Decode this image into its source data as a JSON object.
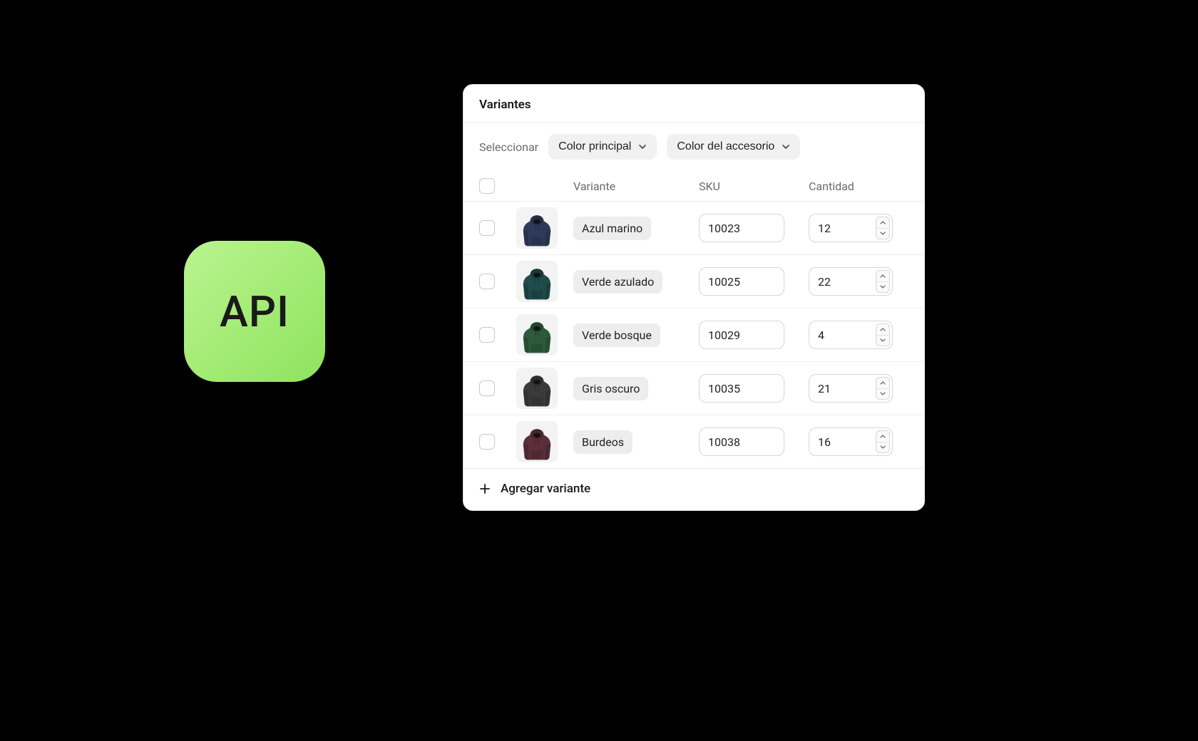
{
  "api_badge": {
    "label": "API"
  },
  "card": {
    "title": "Variantes",
    "filter": {
      "label": "Seleccionar",
      "primary_color_label": "Color principal",
      "accessory_color_label": "Color del accesorio"
    },
    "columns": {
      "variant": "Variante",
      "sku": "SKU",
      "qty": "Cantidad"
    },
    "rows": [
      {
        "name": "Azul marino",
        "sku": "10023",
        "qty": "12",
        "swatch": "#2f3a5a"
      },
      {
        "name": "Verde azulado",
        "sku": "10025",
        "qty": "22",
        "swatch": "#1f4c4a"
      },
      {
        "name": "Verde bosque",
        "sku": "10029",
        "qty": "4",
        "swatch": "#2d5a3a"
      },
      {
        "name": "Gris oscuro",
        "sku": "10035",
        "qty": "21",
        "swatch": "#3a3a3a"
      },
      {
        "name": "Burdeos",
        "sku": "10038",
        "qty": "16",
        "swatch": "#5a2f3a"
      }
    ],
    "add_label": "Agregar variante"
  }
}
